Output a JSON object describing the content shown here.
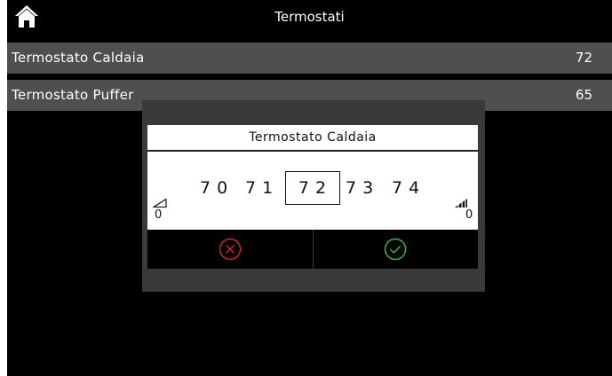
{
  "header": {
    "title": "Termostati",
    "home_icon": "home-icon"
  },
  "rows": [
    {
      "label": "Termostato Caldaia",
      "value": "72"
    },
    {
      "label": "Termostato Puffer",
      "value": "65"
    }
  ],
  "dialog": {
    "title": "Termostato Caldaia",
    "values": [
      "70",
      "71",
      "72",
      "73",
      "74"
    ],
    "selected": "72",
    "min_label": "0",
    "max_label": "0",
    "cancel_icon": "cancel-x-circle-icon",
    "confirm_icon": "confirm-check-circle-icon"
  },
  "colors": {
    "background": "#000000",
    "row": "#4f4f4f",
    "cancel": "#e0202a",
    "confirm": "#2fbf4a"
  }
}
